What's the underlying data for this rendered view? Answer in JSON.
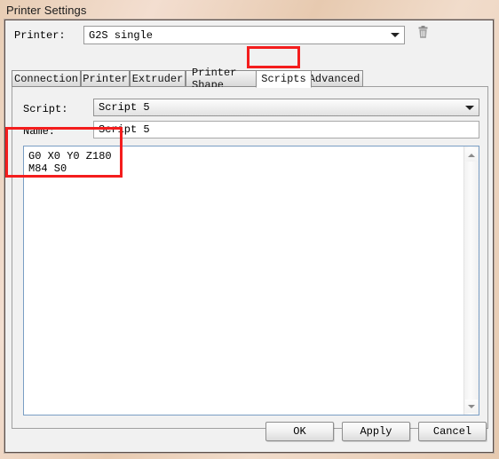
{
  "window": {
    "title": "Printer Settings"
  },
  "printer_row": {
    "label": "Printer:",
    "selected_printer": "G2S single",
    "delete_icon": "trash-icon",
    "dropdown_icon": "chevron-down-icon"
  },
  "tabs": [
    {
      "label": "Connection",
      "selected": false
    },
    {
      "label": "Printer",
      "selected": false
    },
    {
      "label": "Extruder",
      "selected": false
    },
    {
      "label": "Printer Shape",
      "selected": false
    },
    {
      "label": "Scripts",
      "selected": true
    },
    {
      "label": "Advanced",
      "selected": false
    }
  ],
  "scripts_page": {
    "script_label": "Script:",
    "script_selected": "Script 5",
    "script_dropdown_icon": "chevron-down-icon",
    "name_label": "Name:",
    "name_value": "Script 5",
    "name_placeholder": "",
    "editor_text": "G0 X0 Y0 Z180\nM84 S0",
    "scrollbar": {
      "up_icon": "caret-up-icon",
      "down_icon": "caret-down-icon"
    }
  },
  "footer": {
    "ok_label": "OK",
    "apply_label": "Apply",
    "cancel_label": "Cancel"
  },
  "annotations": {
    "accent_color": "#f41d1d",
    "boxes": [
      {
        "name": "scripts-tab-highlight"
      },
      {
        "name": "script-code-highlight"
      }
    ]
  }
}
